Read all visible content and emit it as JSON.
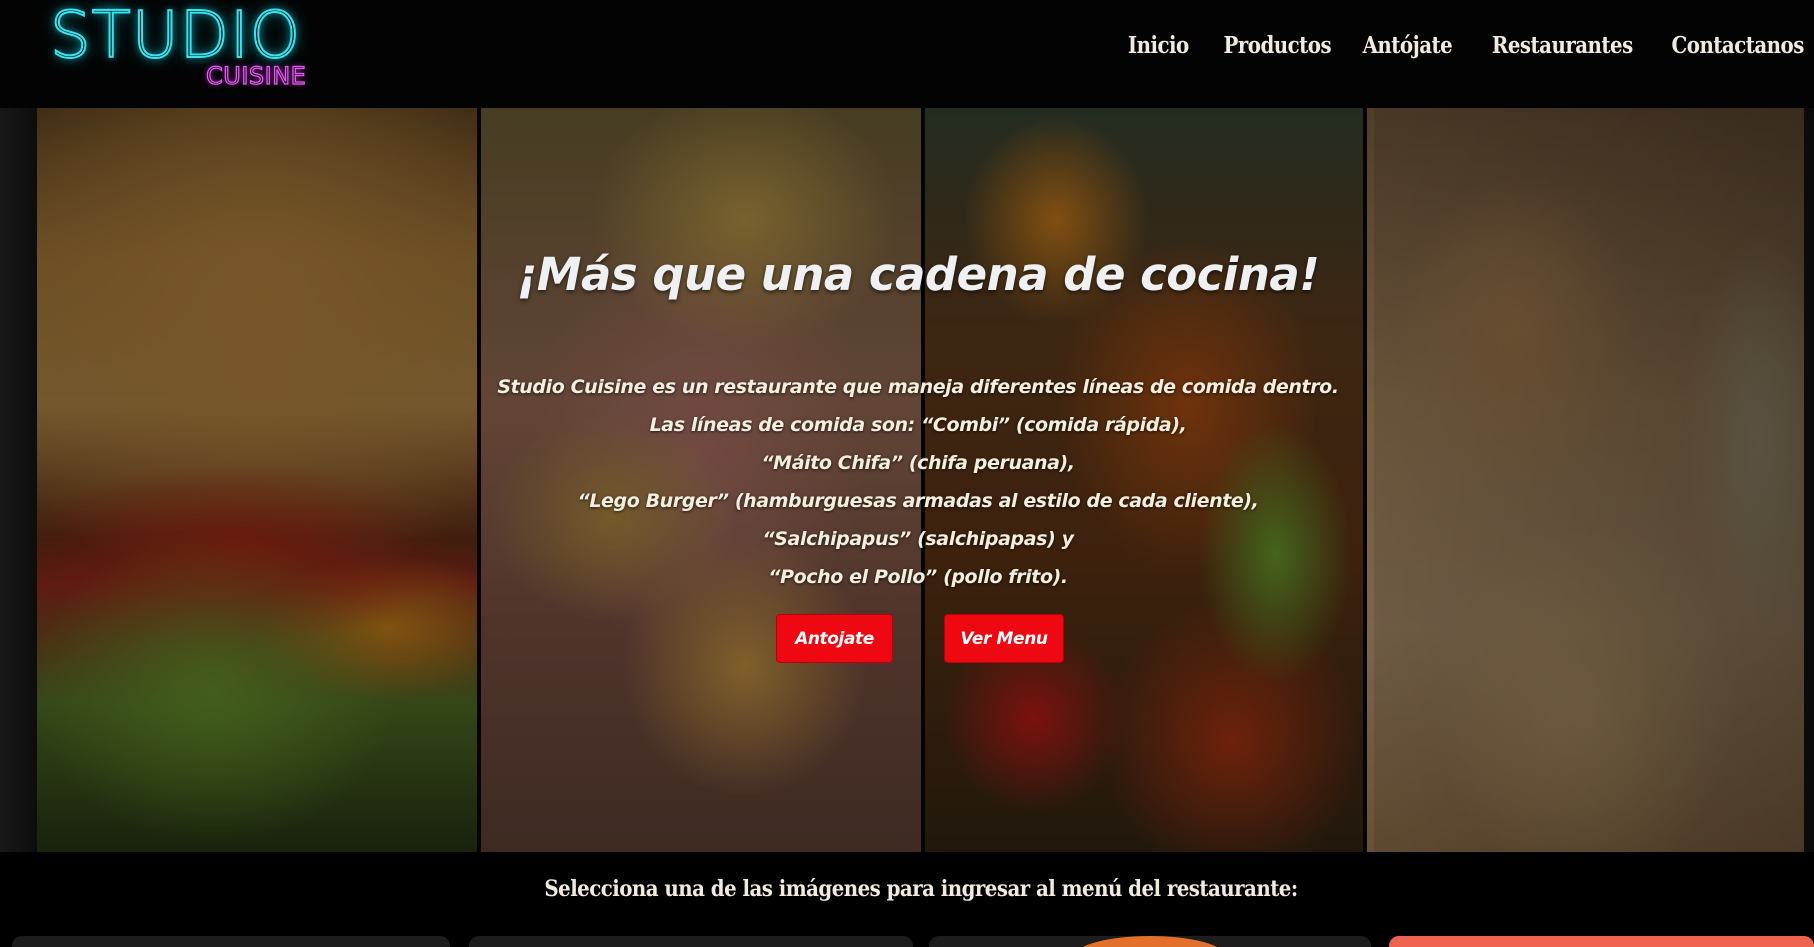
{
  "brand": {
    "logo_main": "STUDIO",
    "logo_sub": "CUISINE",
    "neon_cyan": "#38e3ee",
    "neon_magenta": "#e35cf0"
  },
  "nav": {
    "items": [
      "Inicio",
      "Productos",
      "Antójate",
      "Restaurantes",
      "Contactanos"
    ]
  },
  "hero": {
    "title": "¡Más que una cadena de cocina!",
    "lines": [
      "Studio Cuisine es un restaurante que maneja diferentes líneas de comida dentro.",
      "Las líneas de comida son: “Combi” (comida rápida),",
      "“Máito Chifa” (chifa peruana),",
      "“Lego Burger” (hamburguesas armadas al estilo de cada cliente),",
      "“Salchipapus” (salchipapas) y",
      "“Pocho el Pollo” (pollo frito)."
    ],
    "buttons": {
      "antojate": "Antojate",
      "ver_menu": "Ver Menu"
    },
    "button_color": "#ee0811"
  },
  "restaurants_section": {
    "prompt": "Selecciona una de las imágenes para ingresar al menú del restaurante:"
  }
}
